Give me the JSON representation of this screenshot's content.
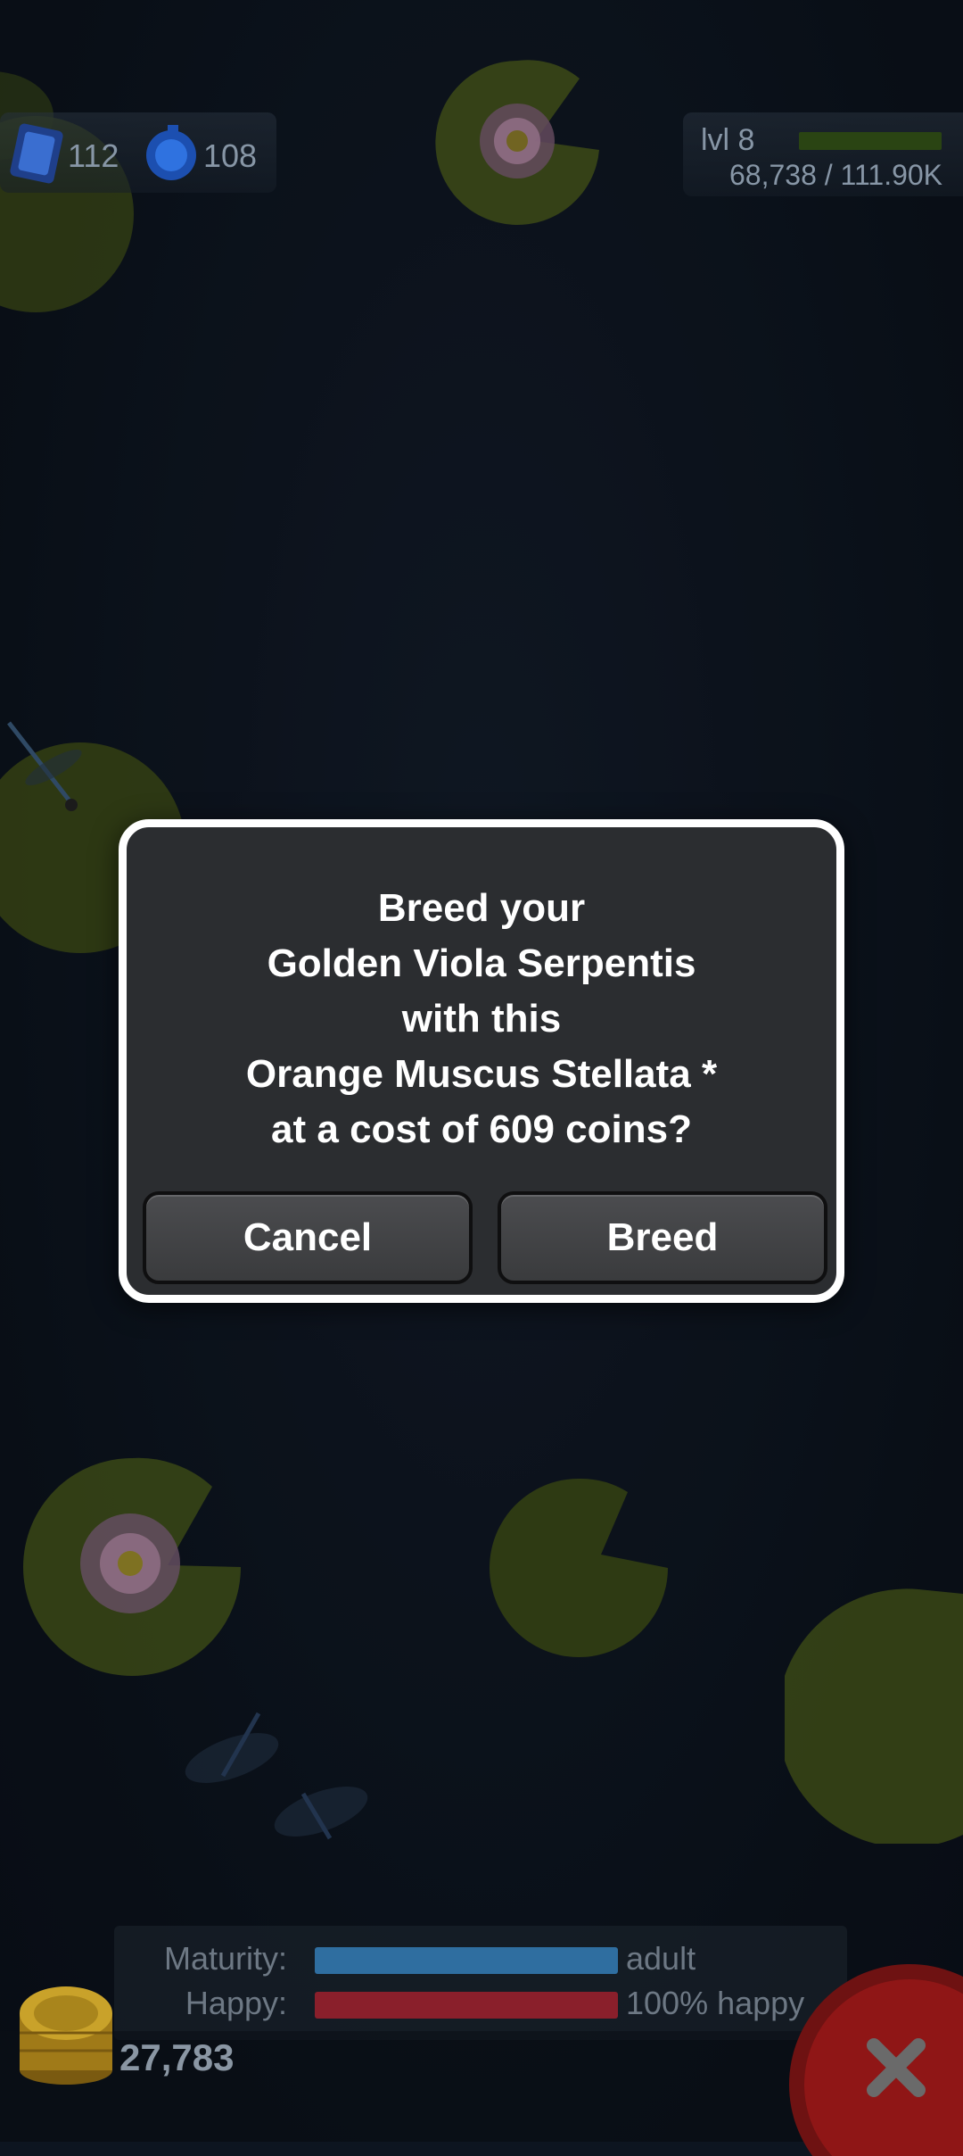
{
  "hud": {
    "gems": "112",
    "potions": "108",
    "level": "lvl 8",
    "xp": "68,738 / 111.90K",
    "xp_progress_percent": 61
  },
  "dialog": {
    "lines": [
      "Breed your",
      "Golden Viola Serpentis",
      "with this",
      "Orange Muscus Stellata *",
      "at a cost of 609 coins?"
    ],
    "cancel_label": "Cancel",
    "breed_label": "Breed"
  },
  "status": {
    "maturity_label": "Maturity:",
    "maturity_value": "adult",
    "happy_label": "Happy:",
    "happy_value": "100% happy"
  },
  "coins": "27,783",
  "colors": {
    "dialog_bg": "#2b2d30",
    "dialog_border": "#ffffff",
    "maturity_bar": "#2f6ea0",
    "happy_bar": "#8a1f2b",
    "xp_bar": "#2a4413",
    "close_button": "#8f1616"
  },
  "icons": {
    "gem": "blue-gem-icon",
    "potion": "blue-potion-icon",
    "coin_stack": "gold-coin-stack-icon",
    "close": "close-icon"
  }
}
